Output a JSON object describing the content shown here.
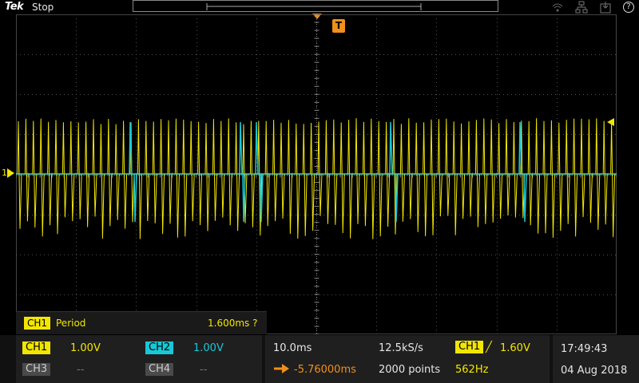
{
  "header": {
    "brand": "Tek",
    "run_state": "Stop"
  },
  "trigger_marker": "T",
  "ch1_marker": "1",
  "measurement": {
    "channel": "CH1",
    "name": "Period",
    "value": "1.600ms ?"
  },
  "channels": {
    "ch1": {
      "label": "CH1",
      "scale": "1.00V"
    },
    "ch2": {
      "label": "CH2",
      "scale": "1.00V"
    },
    "ch3": {
      "label": "CH3",
      "scale": "--"
    },
    "ch4": {
      "label": "CH4",
      "scale": "--"
    }
  },
  "horizontal": {
    "timebase": "10.0ms",
    "sample_rate": "12.5kS/s",
    "position": "-5.76000ms",
    "record_length": "2000 points"
  },
  "trigger": {
    "source": "CH1",
    "slope": "╱",
    "level": "1.60V",
    "frequency": "562Hz"
  },
  "datetime": {
    "time": "17:49:43",
    "date": "04 Aug 2018"
  },
  "colors": {
    "ch1": "#f2e600",
    "ch2": "#19c8d8",
    "trigger": "#f0901a",
    "grid": "#505050"
  },
  "icons": [
    "wifi-icon",
    "network-icon",
    "save-icon",
    "help-icon"
  ]
}
